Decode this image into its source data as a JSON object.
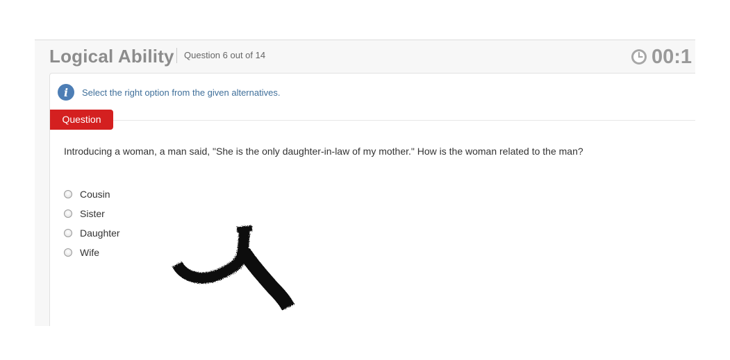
{
  "header": {
    "title": "Logical Ability",
    "question_count": "Question 6 out of 14",
    "timer": "00:1",
    "timer_icon": "clock-icon"
  },
  "info": {
    "icon": "info-icon",
    "icon_glyph": "i",
    "text": "Select the right option from the given alternatives."
  },
  "question": {
    "tab_label": "Question",
    "text": "Introducing a woman, a man said, \"She is the only daughter-in-law of my mother.\" How is the woman related to the man?",
    "options": [
      {
        "label": "Cousin",
        "selected": false
      },
      {
        "label": "Sister",
        "selected": false
      },
      {
        "label": "Daughter",
        "selected": false
      },
      {
        "label": "Wife",
        "selected": false
      }
    ]
  },
  "colors": {
    "accent_red": "#d42020",
    "info_blue": "#4d7eb5",
    "title_gray": "#8c8c8c"
  }
}
